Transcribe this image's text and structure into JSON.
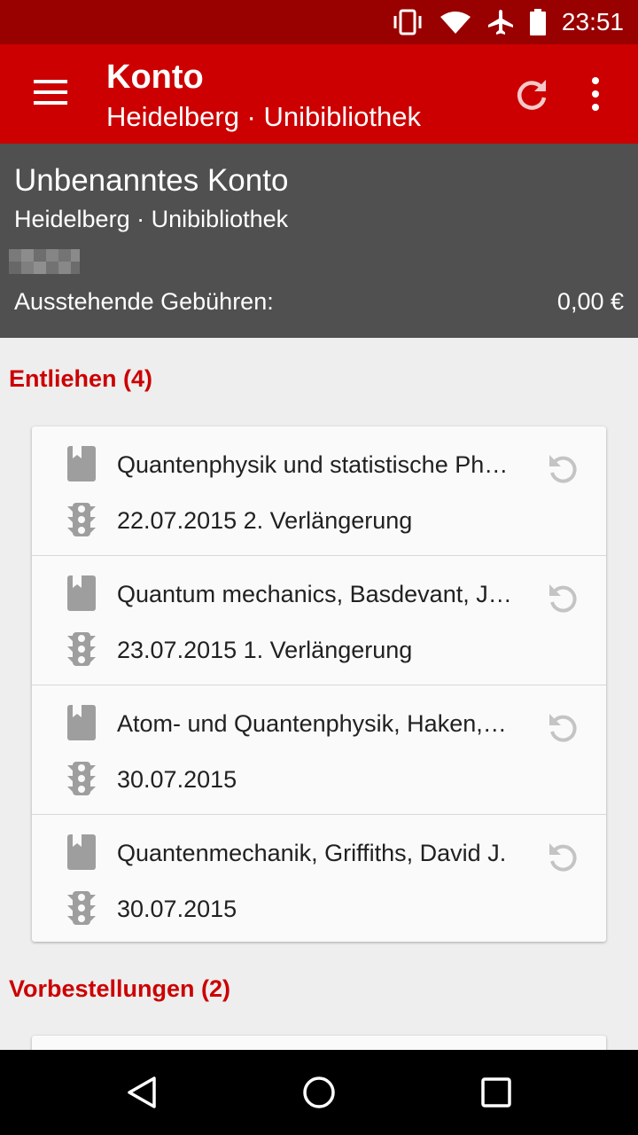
{
  "status_bar": {
    "time": "23:51",
    "icons": [
      "vibrate-icon",
      "wifi-icon",
      "airplane-mode-icon",
      "battery-icon"
    ]
  },
  "app_bar": {
    "title": "Konto",
    "subtitle": "Heidelberg · Unibibliothek",
    "icons": [
      "menu-icon",
      "refresh-icon",
      "overflow-menu-icon"
    ]
  },
  "account": {
    "name": "Unbenanntes Konto",
    "library": "Heidelberg · Unibibliothek",
    "fees_label": "Ausstehende Gebühren:",
    "fees_value": "0,00 €"
  },
  "lent": {
    "header": "Entliehen (4)",
    "items": [
      {
        "title": "Quantenphysik und statistische Ph…",
        "due": "22.07.2015 2. Verlängerung"
      },
      {
        "title": "Quantum mechanics, Basdevant, J…",
        "due": "23.07.2015 1. Verlängerung"
      },
      {
        "title": "Atom- und Quantenphysik, Haken,…",
        "due": "30.07.2015"
      },
      {
        "title": "Quantenmechanik, Griffiths, David J.",
        "due": "30.07.2015"
      }
    ]
  },
  "reservations": {
    "header": "Vorbestellungen (2)"
  },
  "colors": {
    "status_bar": "#990000",
    "app_bar": "#cc0000",
    "account_header": "#505050",
    "section_title": "#cc0000",
    "icon_grey": "#9e9e9e"
  }
}
